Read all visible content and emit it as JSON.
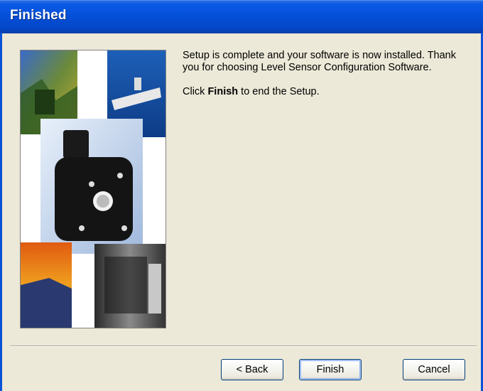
{
  "window": {
    "title": "Finished"
  },
  "message": {
    "line1": "Setup is complete and your software is now installed. Thank you for choosing Level Sensor Configuration Software.",
    "line2_prefix": "Click ",
    "line2_bold": "Finish",
    "line2_suffix": " to end the Setup."
  },
  "buttons": {
    "back": "< Back",
    "finish": "Finish",
    "cancel": "Cancel"
  },
  "colors": {
    "titlebar": "#0550D8",
    "dialog_bg": "#ECE9D8",
    "button_border": "#003C74"
  }
}
